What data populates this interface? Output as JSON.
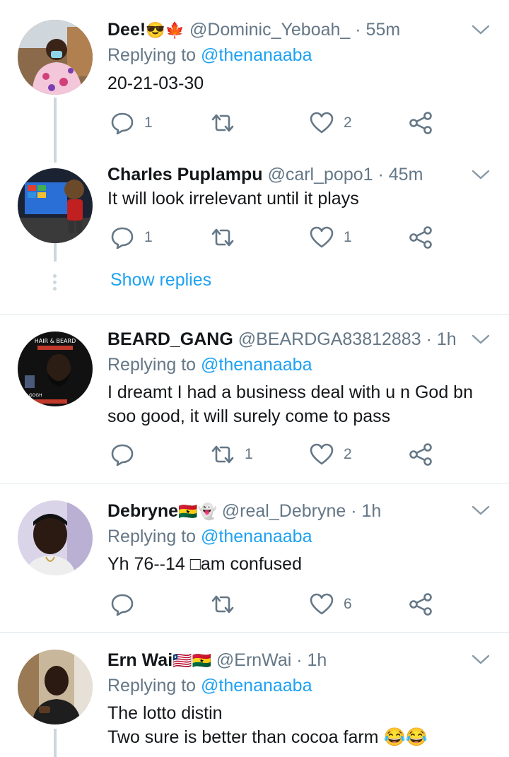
{
  "tweets": [
    {
      "name": "Dee!",
      "name_emoji": "😎🍁",
      "handle": "@Dominic_Yeboah_",
      "time": "55m",
      "replying_prefix": "Replying to ",
      "replying_to": "@thenanaaba",
      "text": "20-21-03-30",
      "replies": "1",
      "retweets": "",
      "likes": "2"
    },
    {
      "name": "Charles Puplampu",
      "name_emoji": "",
      "handle": "@carl_popo1",
      "time": "45m",
      "text": "It will look irrelevant until it plays",
      "replies": "1",
      "retweets": "",
      "likes": "1",
      "show_replies": "Show replies"
    },
    {
      "name": "BEARD_GANG",
      "name_emoji": "",
      "handle": "@BEARDGA83812883",
      "time": "1h",
      "replying_prefix": "Replying to ",
      "replying_to": "@thenanaaba",
      "text": "I dreamt I had a business deal with u n God bn soo good, it will surely come to pass",
      "replies": "",
      "retweets": "1",
      "likes": "2",
      "avatar_text_top": "HAIR & BEARD",
      "avatar_text_bottom": "GOGH"
    },
    {
      "name": "Debryne",
      "name_emoji": "🇬🇭👻",
      "handle": "@real_Debryne",
      "time": "1h",
      "replying_prefix": "Replying to ",
      "replying_to": "@thenanaaba",
      "text": "Yh 76--14 □am confused",
      "replies": "",
      "retweets": "",
      "likes": "6"
    },
    {
      "name": "Ern Wai",
      "name_emoji": "🇱🇷🇬🇭",
      "handle": "@ErnWai",
      "time": "1h",
      "replying_prefix": "Replying to ",
      "replying_to": "@thenanaaba",
      "text": "The lotto distin\nTwo sure is better than cocoa farm 😂😂"
    }
  ],
  "separator": " · ",
  "colors": {
    "accent": "#1da1f2",
    "muted": "#657786",
    "divider": "#e1e8ed",
    "thread": "#ccd6dd"
  }
}
